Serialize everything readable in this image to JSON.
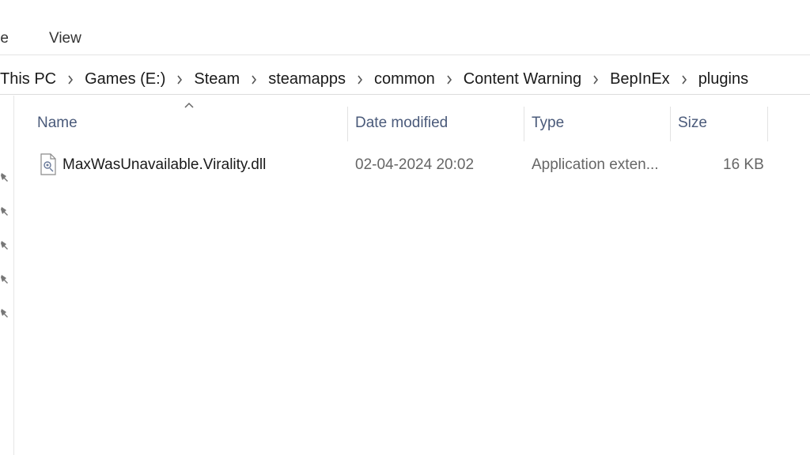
{
  "ribbon": {
    "tabs": [
      "re",
      "View"
    ]
  },
  "address": {
    "crumbs": [
      "This PC",
      "Games (E:)",
      "Steam",
      "steamapps",
      "common",
      "Content Warning",
      "BepInEx",
      "plugins"
    ]
  },
  "columns": {
    "name": "Name",
    "date": "Date modified",
    "type": "Type",
    "size": "Size"
  },
  "files": [
    {
      "name": "MaxWasUnavailable.Virality.dll",
      "date": "02-04-2024 20:02",
      "type": "Application exten...",
      "size": "16 KB",
      "icon": "dll-file-icon"
    }
  ],
  "nav": {
    "pin_icon": "pin-icon",
    "pin_count": 5
  },
  "colors": {
    "header_text": "#4a5a7a",
    "secondary_text": "#666666"
  }
}
